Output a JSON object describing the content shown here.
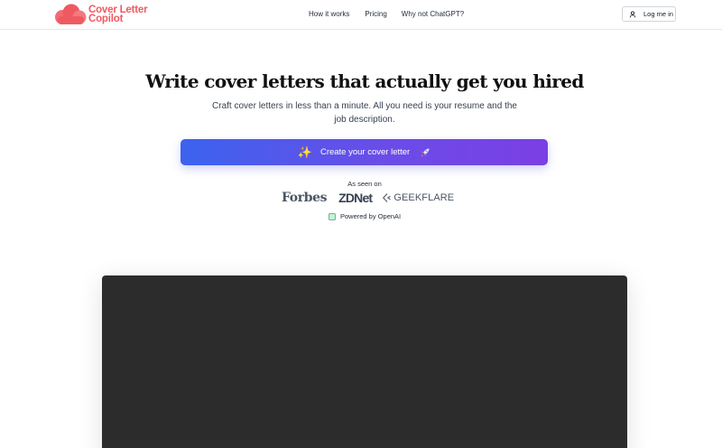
{
  "brand": {
    "name_line1": "Cover Letter",
    "name_line2": "Copilot",
    "color": "#ef5a62"
  },
  "nav": {
    "items": [
      {
        "label": "How it works"
      },
      {
        "label": "Pricing"
      },
      {
        "label": "Why not ChatGPT?"
      }
    ],
    "login_label": "Log me in",
    "login_icon": "user-icon"
  },
  "hero": {
    "title": "Write cover letters that actually get you hired",
    "subtitle": "Craft cover letters in less than a minute. All you need is your resume and the job description.",
    "cta_label": "Create your cover letter",
    "cta_icon_left": "sparkles-icon",
    "cta_icon_right": "rocket-icon",
    "cta_gradient": [
      "#3b63ee",
      "#7b3fe4"
    ]
  },
  "press": {
    "heading": "As seen on",
    "logos": [
      "Forbes",
      "ZDNet",
      "GEEKFLARE"
    ]
  },
  "powered": {
    "label": "Powered by OpenAI",
    "icon": "openai-icon"
  },
  "media": {
    "background": "#2c2c2c"
  }
}
